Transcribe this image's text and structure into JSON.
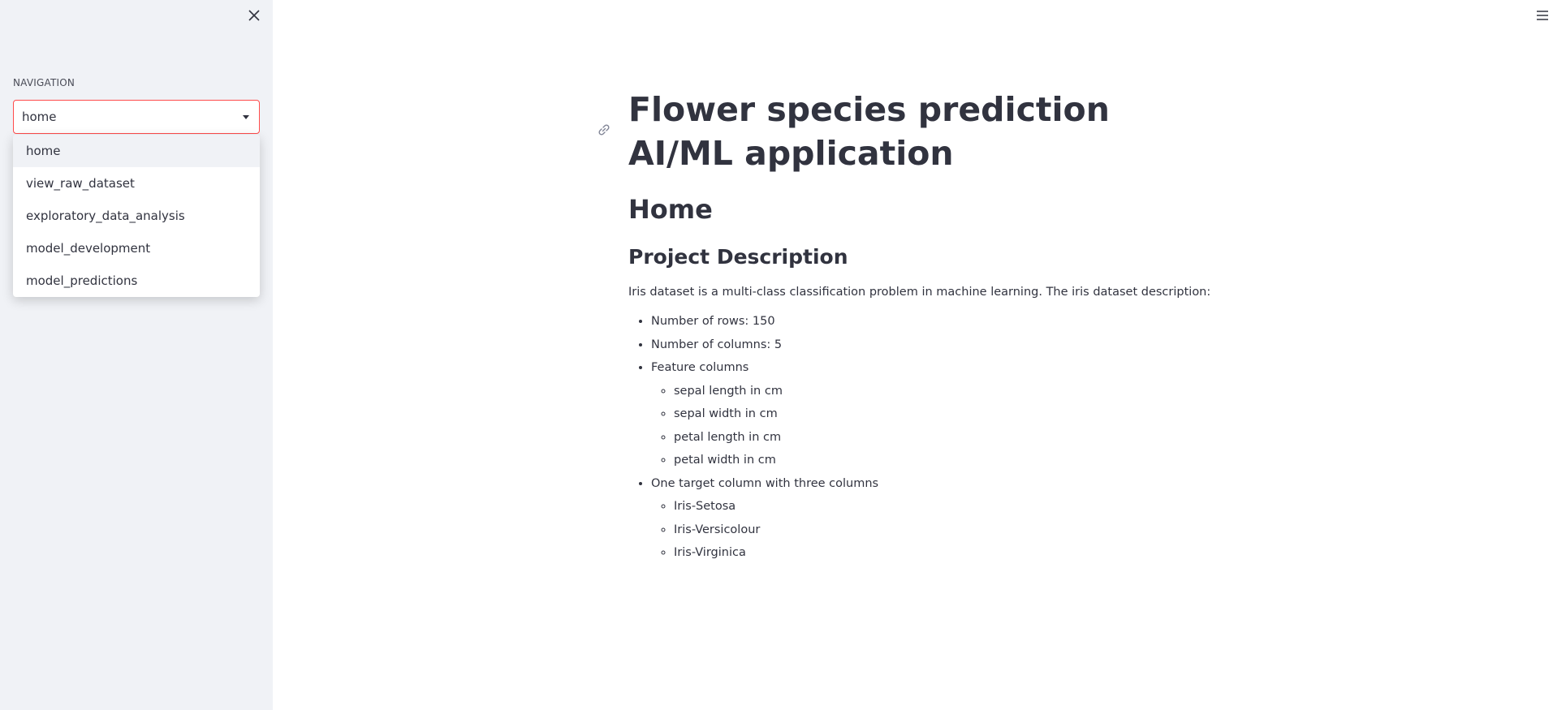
{
  "sidebar": {
    "nav_label": "NAVIGATION",
    "select_value": "home",
    "options": [
      "home",
      "view_raw_dataset",
      "exploratory_data_analysis",
      "model_development",
      "model_predictions"
    ]
  },
  "main": {
    "title": "Flower species prediction AI/ML application",
    "home_heading": "Home",
    "section_heading": "Project Description",
    "description": "Iris dataset is a multi-class classification problem in machine learning. The iris dataset description:",
    "bullets": {
      "rows": "Number of rows: 150",
      "columns": "Number of columns: 5",
      "features": "Feature columns",
      "feature_items": [
        "sepal length in cm",
        "sepal width in cm",
        "petal length in cm",
        "petal width in cm"
      ],
      "target": "One target column with three columns",
      "target_items": [
        "Iris-Setosa",
        "Iris-Versicolour",
        "Iris-Virginica"
      ]
    }
  },
  "icons": {
    "close": "close-icon",
    "menu": "hamburger-menu-icon",
    "anchor": "link-icon",
    "caret": "chevron-down-icon"
  },
  "colors": {
    "sidebar_bg": "#f0f2f6",
    "accent": "#ff4b4b",
    "text": "#31333f"
  }
}
